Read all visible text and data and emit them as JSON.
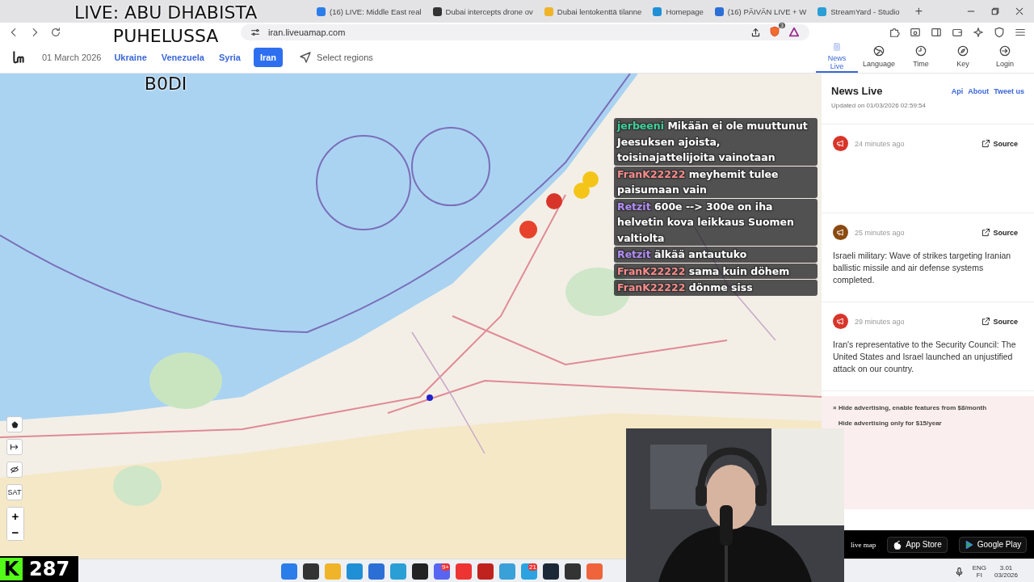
{
  "browser": {
    "tabs": [
      {
        "title": "(16) LIVE: Middle East real",
        "selected": false
      },
      {
        "title": "Dubai intercepts drone ov",
        "selected": false
      },
      {
        "title": "Dubai lentokenttä tilanne",
        "selected": false
      },
      {
        "title": "Homepage",
        "selected": false
      },
      {
        "title": "(16) PÄIVÄN LIVE + W",
        "selected": false
      },
      {
        "title": "StreamYard - Studio",
        "selected": false
      }
    ],
    "new_tab": "+",
    "url": "iran.liveuamap.com",
    "shield_badge": "3"
  },
  "header": {
    "date": "01 March 2026",
    "regions": [
      {
        "label": "Ukraine",
        "selected": false
      },
      {
        "label": "Venezuela",
        "selected": false
      },
      {
        "label": "Syria",
        "selected": false
      },
      {
        "label": "Iran",
        "selected": true
      }
    ],
    "select_regions": "Select regions",
    "nav": [
      {
        "label": "News Live",
        "selected": true
      },
      {
        "label": "Language",
        "selected": false
      },
      {
        "label": "Time",
        "selected": false
      },
      {
        "label": "Key",
        "selected": false
      },
      {
        "label": "Login",
        "selected": false
      }
    ]
  },
  "map": {
    "kind": "picture",
    "controls": {
      "sat": "SAT",
      "zoom_in": "+",
      "zoom_out": "−"
    }
  },
  "news": {
    "title": "News Live",
    "links": [
      "Api",
      "About",
      "Tweet us"
    ],
    "updated": "Updated on 01/03/2026 02:59:54",
    "items": [
      {
        "color": "#d8352a",
        "time": "24 minutes ago",
        "source": "Source"
      },
      {
        "color": "#8a4a10",
        "time": "25 minutes ago",
        "source": "Source",
        "text": "Israeli military: Wave of strikes targeting Iranian ballistic missile and air defense systems completed."
      },
      {
        "color": "#d8352a",
        "time": "29 minutes ago",
        "source": "Source",
        "text": "Iran's representative to the Security Council: The United States and Israel launched an unjustified attack on our country."
      }
    ],
    "ad": {
      "close": "×",
      "line1": "Hide advertising, enable features from $8/month",
      "line2": "Hide advertising only for $15/year"
    },
    "apps": {
      "site": "live map",
      "app_store": "App Store",
      "google_play": "Google Play"
    }
  },
  "taskbar": {
    "badges": [
      "9+",
      "21"
    ],
    "lang": "ENG",
    "region": "FI",
    "time": "3.01",
    "date": "03/2026"
  },
  "stream": {
    "title": [
      "LIVE: ABU DHABISTA",
      "PUHELUSSA",
      "B0DI"
    ],
    "kick_logo": "K",
    "viewers": "287",
    "chat": [
      {
        "user": "jerbeeni",
        "color": "#3ccf9a",
        "text": "Mikään ei ole muuttunut Jeesuksen ajoista, toisinajattelijoita vainotaan"
      },
      {
        "user": "FranK22222",
        "color": "#f58a8a",
        "text": "meyhemit tulee paisumaan vain"
      },
      {
        "user": "Retzit",
        "color": "#b08cf5",
        "text": "600e --> 300e on iha helvetin kova leikkaus Suomen valtiolta"
      },
      {
        "user": "Retzit",
        "color": "#b08cf5",
        "text": "älkää antautuko"
      },
      {
        "user": "FranK22222",
        "color": "#f58a8a",
        "text": "sama kuin döhem"
      },
      {
        "user": "FranK22222",
        "color": "#f58a8a",
        "text": "dönme siss"
      }
    ]
  }
}
